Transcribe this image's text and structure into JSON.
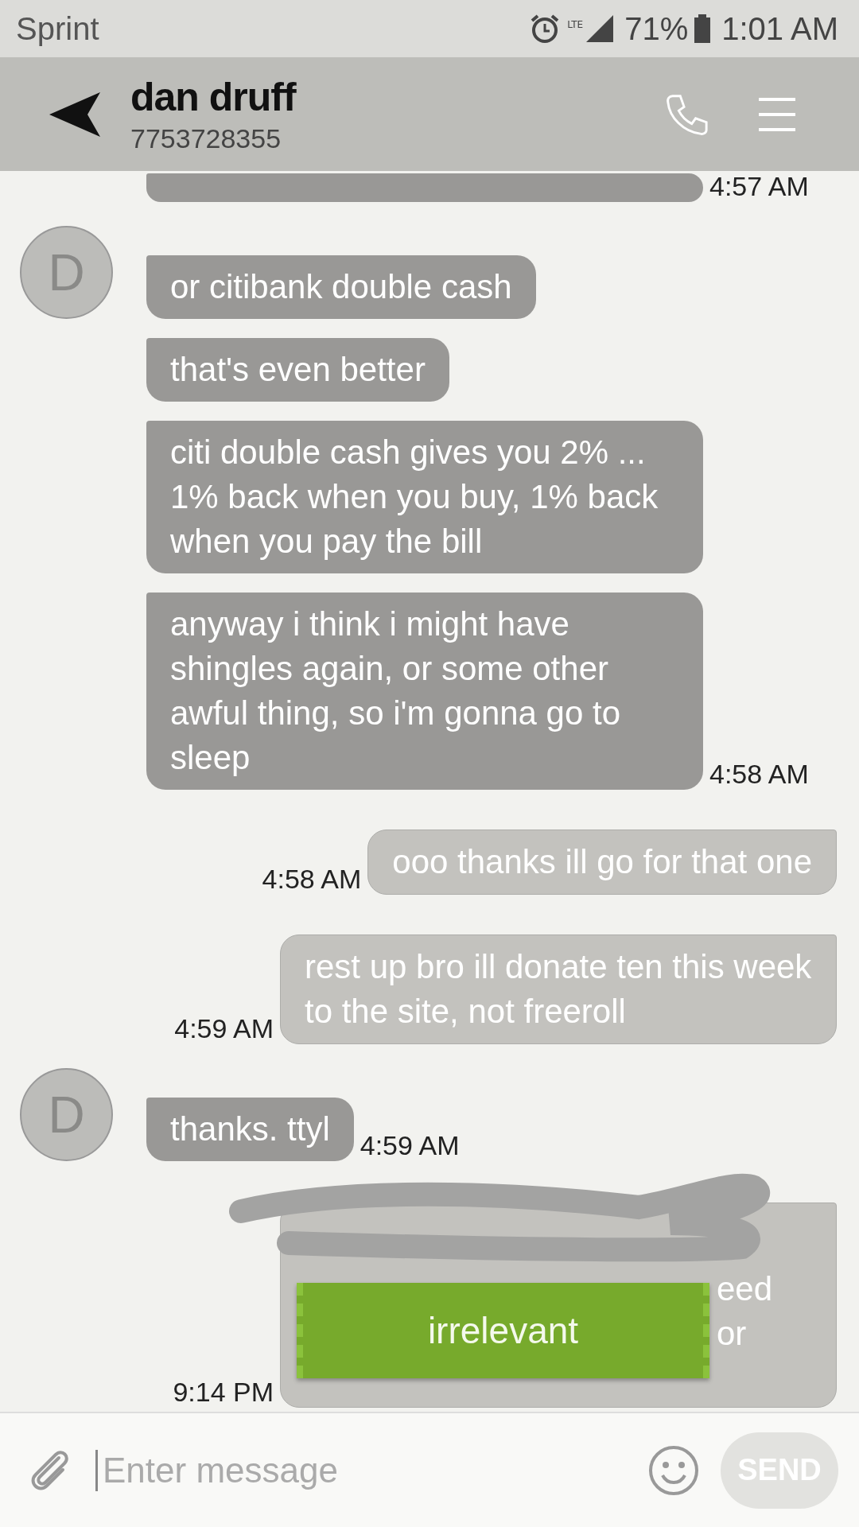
{
  "status_bar": {
    "carrier": "Sprint",
    "network": "LTE",
    "battery": "71%",
    "time": "1:01 AM"
  },
  "header": {
    "name": "dan druff",
    "number": "7753728355"
  },
  "messages": [
    {
      "kind": "partial",
      "time": "4:57 AM"
    },
    {
      "kind": "received",
      "text": "or citibank double cash",
      "avatar_letter": "D"
    },
    {
      "kind": "received",
      "text": "that's even better"
    },
    {
      "kind": "received",
      "text": "citi double cash gives you 2% ...  1% back when you buy, 1% back when you pay the bill"
    },
    {
      "kind": "received",
      "text": "anyway i think i might have shingles again, or some other awful thing, so i'm gonna go to sleep",
      "time": "4:58 AM"
    },
    {
      "kind": "sent",
      "text": "ooo thanks ill go for that one",
      "time": "4:58 AM"
    },
    {
      "kind": "sent",
      "text": "rest up bro ill donate ten this week to the site, not freeroll",
      "time": "4:59 AM"
    },
    {
      "kind": "received",
      "text": "thanks.  ttyl",
      "time": "4:59 AM",
      "avatar_letter": "D"
    },
    {
      "kind": "obscured",
      "fragments": [
        "eed",
        "or"
      ],
      "time": "9:14 PM",
      "sticker": "irrelevant"
    }
  ],
  "composer": {
    "placeholder": "Enter message",
    "send": "SEND"
  }
}
